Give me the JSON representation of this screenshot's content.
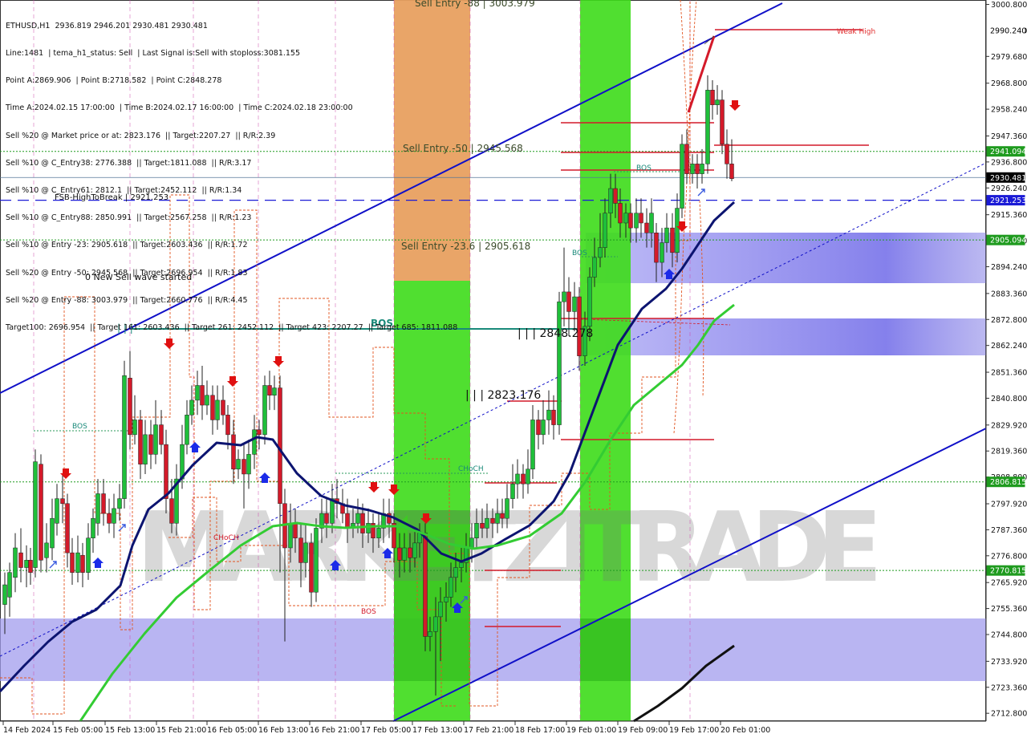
{
  "chart_data": {
    "type": "candlestick",
    "symbol": "ETHUSD,H1",
    "ohlc": {
      "open": 2936.819,
      "high": 2946.201,
      "low": 2930.481,
      "close": 2930.481
    },
    "info_lines": [
      "ETHUSD,H1  2936.819 2946.201 2930.481 2930.481",
      "Line:1481  | tema_h1_status: Sell  | Last Signal is:Sell with stoploss:3081.155",
      "Point A:2869.906  | Point B:2718.582  | Point C:2848.278",
      "Time A:2024.02.15 17:00:00  | Time B:2024.02.17 16:00:00  | Time C:2024.02.18 23:00:00",
      "Sell %20 @ Market price or at: 2823.176  || Target:2207.27  || R/R:2.39",
      "Sell %10 @ C_Entry38: 2776.388  || Target:1811.088  || R/R:3.17",
      "Sell %10 @ C_Entry61: 2812.1  || Target:2452.112  || R/R:1.34",
      "Sell %10 @ C_Entry88: 2850.991  || Target:2567.258  || R/R:1.23",
      "Sell %10 @ Entry -23: 2905.618  || Target:2603.436  || R/R:1.72",
      "Sell %20 @ Entry -50: 2945.568  || Target:2696.954  || R/R:1.83",
      "Sell %20 @ Entry -88: 3003.979  || Target:2660.776  || R/R:4.45",
      "Target100: 2696.954  || Target 161: 2603.436  || Target 261: 2452.112  || Target 423: 2207.27  || Target 685: 1811.088"
    ],
    "y_ticks": [
      "3000.800",
      "2990.240",
      "2979.680",
      "2968.800",
      "2958.240",
      "2947.360",
      "2936.800",
      "2926.240",
      "2915.360",
      "2904.800",
      "2894.240",
      "2883.360",
      "2872.800",
      "2862.240",
      "2851.360",
      "2840.800",
      "2829.920",
      "2819.360",
      "2808.800",
      "2797.920",
      "2787.360",
      "2776.800",
      "2765.920",
      "2755.360",
      "2744.800",
      "2733.920",
      "2723.360",
      "2712.800"
    ],
    "ylim": [
      2709.6,
      3002.6
    ],
    "x_ticks": [
      "14 Feb 2024",
      "15 Feb 05:00",
      "15 Feb 13:00",
      "15 Feb 21:00",
      "16 Feb 05:00",
      "16 Feb 13:00",
      "16 Feb 21:00",
      "17 Feb 05:00",
      "17 Feb 13:00",
      "17 Feb 21:00",
      "18 Feb 17:00",
      "19 Feb 01:00",
      "19 Feb 09:00",
      "19 Feb 17:00",
      "20 Feb 01:00"
    ],
    "price_badges": [
      {
        "value": "2990.240",
        "color": "#ffffff",
        "text_color": "#000000"
      },
      {
        "value": "2941.094",
        "color": "#1f9b1f",
        "text_color": "#ffffff"
      },
      {
        "value": "2930.481",
        "color": "#000000",
        "text_color": "#ffffff"
      },
      {
        "value": "2921.253",
        "color": "#1b1bd6",
        "text_color": "#ffffff"
      },
      {
        "value": "2905.094",
        "color": "#1f9b1f",
        "text_color": "#ffffff"
      },
      {
        "value": "2806.815",
        "color": "#1f9b1f",
        "text_color": "#ffffff"
      },
      {
        "value": "2770.815",
        "color": "#1f9b1f",
        "text_color": "#ffffff"
      }
    ],
    "annotations": {
      "sell_entry_88": "Sell Entry -88 | 3003.979",
      "sell_entry_50": "Sell Entry -50 | 2945.568",
      "sell_entry_23": "Sell Entry -23.6 | 2905.618",
      "fsb": "FSB-HighToBreak | 2921.253",
      "new_wave": "0 New Sell wave started",
      "bos_big": "BOS",
      "bos_small_1": "BOS",
      "bos_small_2": "BOS",
      "bos_small_3": "BOS",
      "bos_small_4": "BOS",
      "choch_1": "CHoCH",
      "choch_2": "CHoCH",
      "point_c": "| | | 2848.278",
      "point_market": "| | | 2823.176",
      "weak_high": "Weak High",
      "watermark": "MARKETZITRADE"
    },
    "colors": {
      "bull": "#1fbf3a",
      "bear": "#d41a2a",
      "channel": "#1010c8",
      "tema_navy": "#0c1470",
      "ma_green": "#33cc33",
      "green_zone": "#3ddc1a",
      "orange_zone": "#e8a060",
      "supply_zone": "#8a84ee",
      "level_dotted": "#1f9b1f",
      "level_red": "#d41a2a"
    }
  }
}
